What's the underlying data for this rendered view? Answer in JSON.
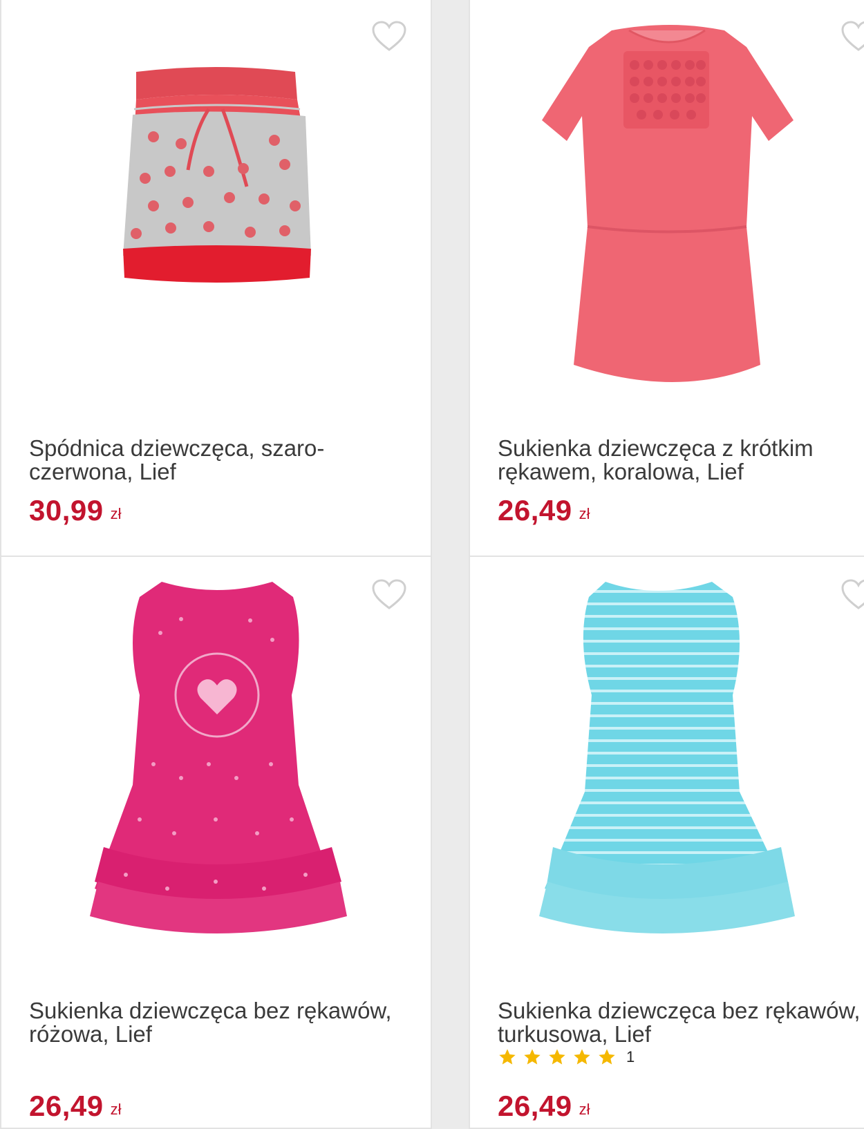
{
  "products": [
    {
      "title": "Spódnica dziewczęca, szaro-czerwona, Lief",
      "price": "30,99",
      "currency": "zł",
      "image_icon": "skirt-icon"
    },
    {
      "title": "Sukienka dziewczęca z krótkim rękawem, koralowa, Lief",
      "price": "26,49",
      "currency": "zł",
      "image_icon": "dress-icon"
    },
    {
      "title": "Sukienka dziewczęca bez rękawów, różowa, Lief",
      "price": "26,49",
      "currency": "zł",
      "image_icon": "dress-icon"
    },
    {
      "title": "Sukienka dziewczęca bez rękawów, turkusowa, Lief",
      "price": "26,49",
      "currency": "zł",
      "rating": 5,
      "rating_count": "1",
      "image_icon": "dress-icon"
    }
  ],
  "colors": {
    "price": "#c2142e",
    "star": "#f5b800",
    "heart_outline": "#cfcfcf"
  }
}
